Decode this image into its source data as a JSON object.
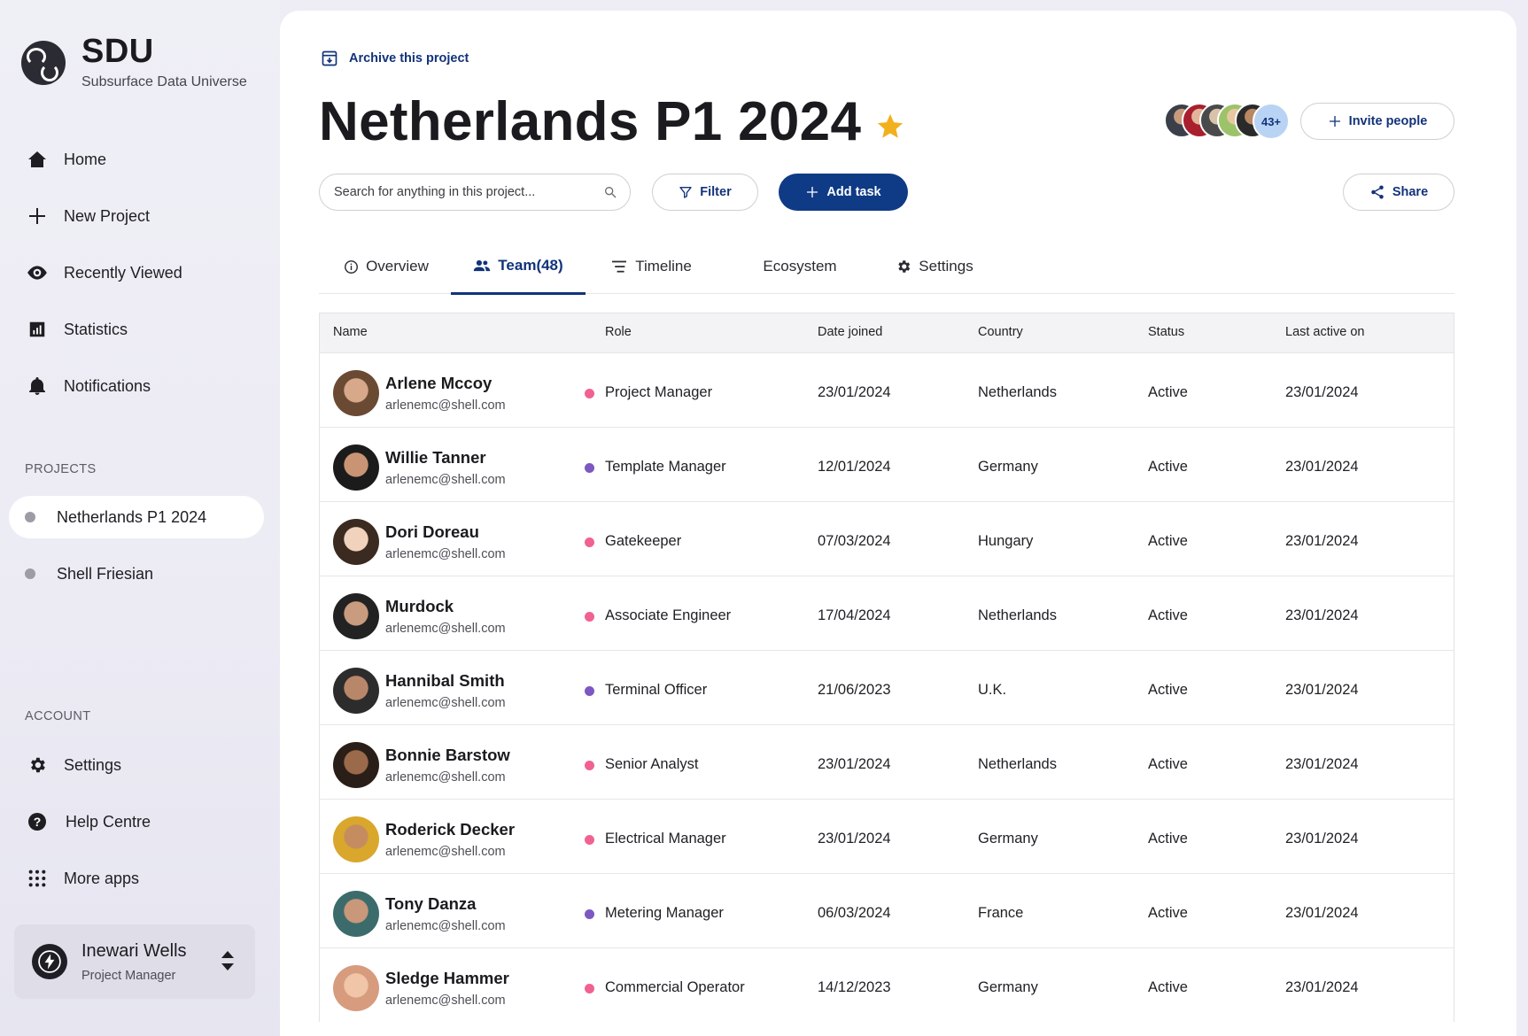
{
  "brand": {
    "title": "SDU",
    "subtitle": "Subsurface Data Universe"
  },
  "nav": [
    {
      "label": "Home",
      "icon": "home-icon"
    },
    {
      "label": "New Project",
      "icon": "plus-icon"
    },
    {
      "label": "Recently Viewed",
      "icon": "eye-icon"
    },
    {
      "label": "Statistics",
      "icon": "chart-icon"
    },
    {
      "label": "Notifications",
      "icon": "bell-icon"
    }
  ],
  "projects": {
    "section_label": "PROJECTS",
    "items": [
      {
        "label": "Netherlands P1 2024",
        "active": true
      },
      {
        "label": "Shell Friesian",
        "active": false
      }
    ]
  },
  "account": {
    "section_label": "ACCOUNT",
    "items": [
      {
        "label": "Settings",
        "icon": "gear-icon"
      },
      {
        "label": "Help Centre",
        "icon": "help-icon"
      },
      {
        "label": "More apps",
        "icon": "grid-icon"
      }
    ]
  },
  "user": {
    "name": "Inewari Wells",
    "role": "Project Manager"
  },
  "header": {
    "archive_label": "Archive this project",
    "title": "Netherlands P1 2024",
    "starred": true,
    "member_overflow": "43+",
    "invite_label": "Invite people"
  },
  "toolbar": {
    "search_placeholder": "Search for anything in this project...",
    "filter_label": "Filter",
    "add_task_label": "Add task",
    "share_label": "Share"
  },
  "tabs": [
    {
      "label": "Overview",
      "icon": "info-icon",
      "active": false
    },
    {
      "label": "Team(48)",
      "icon": "people-icon",
      "active": true
    },
    {
      "label": "Timeline",
      "icon": "timeline-icon",
      "active": false
    },
    {
      "label": "Ecosystem",
      "icon": "",
      "active": false
    },
    {
      "label": "Settings",
      "icon": "gear-icon",
      "active": false
    }
  ],
  "table": {
    "columns": [
      "Name",
      "Role",
      "Date joined",
      "Country",
      "Status",
      "Last active on"
    ],
    "rows": [
      {
        "name": "Arlene Mccoy",
        "email": "arlenemc@shell.com",
        "role": "Project Manager",
        "role_color": "#f06292",
        "date_joined": "23/01/2024",
        "country": "Netherlands",
        "status": "Active",
        "last_active": "23/01/2024"
      },
      {
        "name": "Willie Tanner",
        "email": "arlenemc@shell.com",
        "role": "Template Manager",
        "role_color": "#7e57c2",
        "date_joined": "12/01/2024",
        "country": "Germany",
        "status": "Active",
        "last_active": "23/01/2024"
      },
      {
        "name": "Dori Doreau",
        "email": "arlenemc@shell.com",
        "role": "Gatekeeper",
        "role_color": "#f06292",
        "date_joined": "07/03/2024",
        "country": "Hungary",
        "status": "Active",
        "last_active": "23/01/2024"
      },
      {
        "name": "Murdock",
        "email": "arlenemc@shell.com",
        "role": "Associate Engineer",
        "role_color": "#f06292",
        "date_joined": "17/04/2024",
        "country": "Netherlands",
        "status": "Active",
        "last_active": "23/01/2024"
      },
      {
        "name": "Hannibal Smith",
        "email": "arlenemc@shell.com",
        "role": "Terminal Officer",
        "role_color": "#7e57c2",
        "date_joined": "21/06/2023",
        "country": "U.K.",
        "status": "Active",
        "last_active": "23/01/2024"
      },
      {
        "name": "Bonnie Barstow",
        "email": "arlenemc@shell.com",
        "role": "Senior Analyst",
        "role_color": "#f06292",
        "date_joined": "23/01/2024",
        "country": "Netherlands",
        "status": "Active",
        "last_active": "23/01/2024"
      },
      {
        "name": "Roderick Decker",
        "email": "arlenemc@shell.com",
        "role": "Electrical Manager",
        "role_color": "#f06292",
        "date_joined": "23/01/2024",
        "country": "Germany",
        "status": "Active",
        "last_active": "23/01/2024"
      },
      {
        "name": "Tony Danza",
        "email": "arlenemc@shell.com",
        "role": "Metering Manager",
        "role_color": "#7e57c2",
        "date_joined": "06/03/2024",
        "country": "France",
        "status": "Active",
        "last_active": "23/01/2024"
      },
      {
        "name": "Sledge Hammer",
        "email": "arlenemc@shell.com",
        "role": "Commercial Operator",
        "role_color": "#f06292",
        "date_joined": "14/12/2023",
        "country": "Germany",
        "status": "Active",
        "last_active": "23/01/2024"
      }
    ]
  },
  "colors": {
    "primary": "#0f3a86",
    "accent_text": "#12337a",
    "star": "#f2b01e"
  }
}
